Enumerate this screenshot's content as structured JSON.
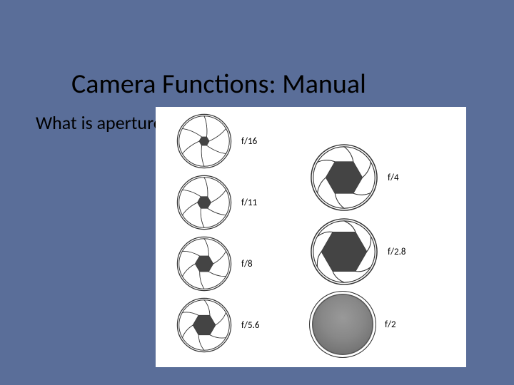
{
  "title": "Camera Functions:  Manual",
  "question": "What is\naperture?",
  "apertures": {
    "left": [
      {
        "label": "f/16",
        "opening": 0.22
      },
      {
        "label": "f/11",
        "opening": 0.3
      },
      {
        "label": "f/8",
        "opening": 0.4
      },
      {
        "label": "f/5.6",
        "opening": 0.5
      }
    ],
    "right": [
      {
        "label": "f/4",
        "opening": 0.66
      },
      {
        "label": "f/2.8",
        "opening": 0.82
      },
      {
        "label": "f/2",
        "opening": 1.0
      }
    ]
  }
}
